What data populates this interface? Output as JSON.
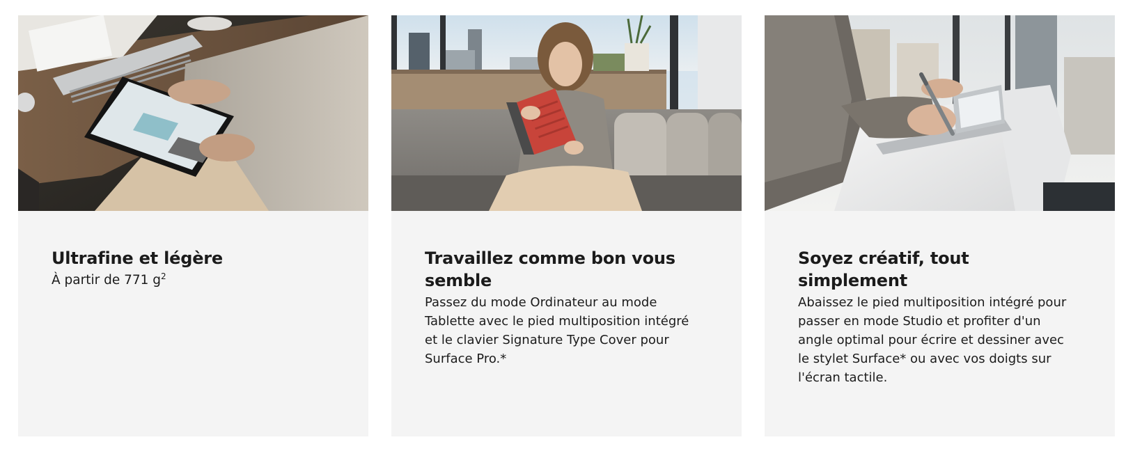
{
  "cards": [
    {
      "title": "Ultrafine et légère",
      "text": "À partir de 771 g",
      "superscript": "2",
      "image_alt": "Person holding a tablet at a desk"
    },
    {
      "title": "Travaillez comme bon vous semble",
      "text": "Passez du mode Ordinateur au mode Tablette avec le pied multiposition intégré et le clavier Signature Type Cover pour Surface Pro.*",
      "image_alt": "Woman sitting on a sofa with a red keyboard cover tablet"
    },
    {
      "title": "Soyez créatif, tout simplement",
      "text": "Abaissez le pied multiposition intégré pour passer en mode Studio et profiter d'un angle optimal pour écrire et dessiner avec le stylet Surface* ou avec vos doigts sur l'écran tactile.",
      "image_alt": "Hand drawing with a stylus on a tablet in studio mode"
    }
  ],
  "colors": {
    "card_background": "#f4f4f4",
    "text": "#1b1b1b",
    "keyboard_cover_red": "#c8443a"
  }
}
